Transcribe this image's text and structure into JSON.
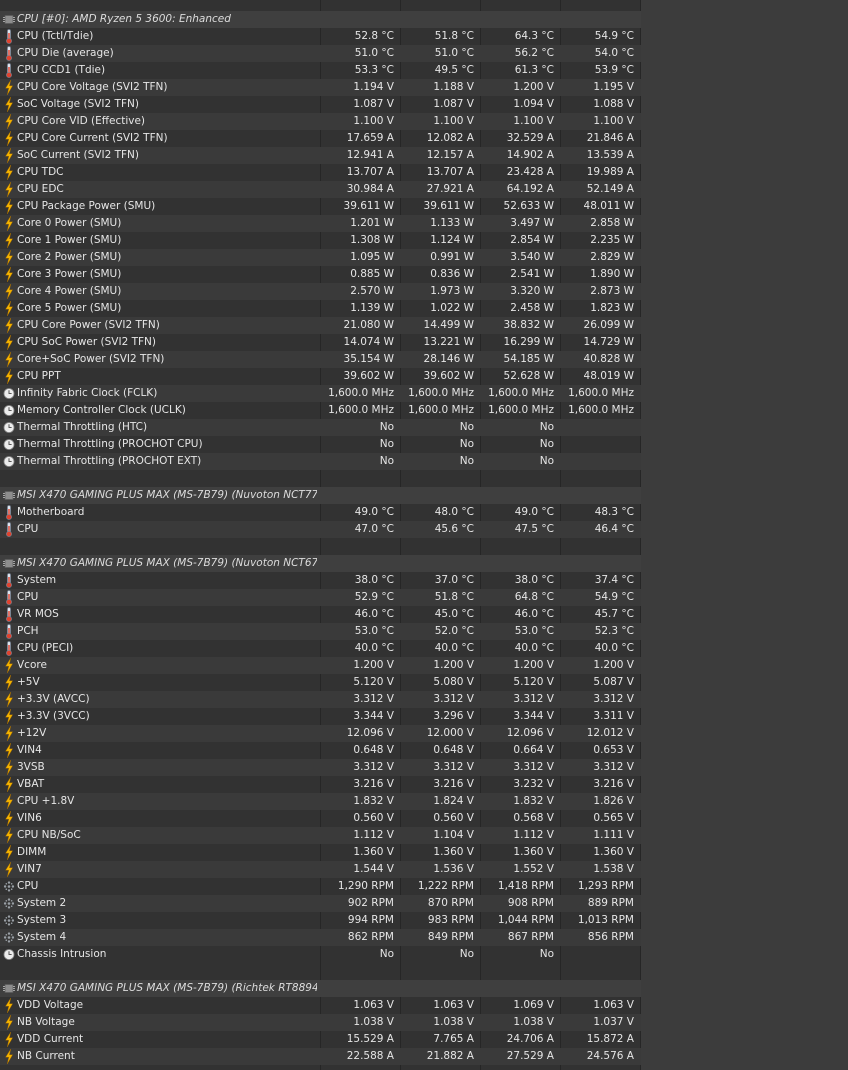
{
  "sections": [
    {
      "title": "CPU [#0]: AMD Ryzen 5 3600: Enhanced",
      "icon": "chip-icon",
      "rows": [
        {
          "icon": "thermometer-icon",
          "label": "CPU (Tctl/Tdie)",
          "values": [
            "52.8 °C",
            "51.8 °C",
            "64.3 °C",
            "54.9 °C"
          ]
        },
        {
          "icon": "thermometer-icon",
          "label": "CPU Die (average)",
          "values": [
            "51.0 °C",
            "51.0 °C",
            "56.2 °C",
            "54.0 °C"
          ]
        },
        {
          "icon": "thermometer-icon",
          "label": "CPU CCD1 (Tdie)",
          "values": [
            "53.3 °C",
            "49.5 °C",
            "61.3 °C",
            "53.9 °C"
          ]
        },
        {
          "icon": "lightning-icon",
          "label": "CPU Core Voltage (SVI2 TFN)",
          "values": [
            "1.194 V",
            "1.188 V",
            "1.200 V",
            "1.195 V"
          ]
        },
        {
          "icon": "lightning-icon",
          "label": "SoC Voltage (SVI2 TFN)",
          "values": [
            "1.087 V",
            "1.087 V",
            "1.094 V",
            "1.088 V"
          ]
        },
        {
          "icon": "lightning-icon",
          "label": "CPU Core VID (Effective)",
          "values": [
            "1.100 V",
            "1.100 V",
            "1.100 V",
            "1.100 V"
          ]
        },
        {
          "icon": "lightning-icon",
          "label": "CPU Core Current (SVI2 TFN)",
          "values": [
            "17.659 A",
            "12.082 A",
            "32.529 A",
            "21.846 A"
          ]
        },
        {
          "icon": "lightning-icon",
          "label": "SoC Current (SVI2 TFN)",
          "values": [
            "12.941 A",
            "12.157 A",
            "14.902 A",
            "13.539 A"
          ]
        },
        {
          "icon": "lightning-icon",
          "label": "CPU TDC",
          "values": [
            "13.707 A",
            "13.707 A",
            "23.428 A",
            "19.989 A"
          ]
        },
        {
          "icon": "lightning-icon",
          "label": "CPU EDC",
          "values": [
            "30.984 A",
            "27.921 A",
            "64.192 A",
            "52.149 A"
          ]
        },
        {
          "icon": "lightning-icon",
          "label": "CPU Package Power (SMU)",
          "values": [
            "39.611 W",
            "39.611 W",
            "52.633 W",
            "48.011 W"
          ]
        },
        {
          "icon": "lightning-icon",
          "label": "Core 0 Power (SMU)",
          "values": [
            "1.201 W",
            "1.133 W",
            "3.497 W",
            "2.858 W"
          ]
        },
        {
          "icon": "lightning-icon",
          "label": "Core 1 Power (SMU)",
          "values": [
            "1.308 W",
            "1.124 W",
            "2.854 W",
            "2.235 W"
          ]
        },
        {
          "icon": "lightning-icon",
          "label": "Core 2 Power (SMU)",
          "values": [
            "1.095 W",
            "0.991 W",
            "3.540 W",
            "2.829 W"
          ]
        },
        {
          "icon": "lightning-icon",
          "label": "Core 3 Power (SMU)",
          "values": [
            "0.885 W",
            "0.836 W",
            "2.541 W",
            "1.890 W"
          ]
        },
        {
          "icon": "lightning-icon",
          "label": "Core 4 Power (SMU)",
          "values": [
            "2.570 W",
            "1.973 W",
            "3.320 W",
            "2.873 W"
          ]
        },
        {
          "icon": "lightning-icon",
          "label": "Core 5 Power (SMU)",
          "values": [
            "1.139 W",
            "1.022 W",
            "2.458 W",
            "1.823 W"
          ]
        },
        {
          "icon": "lightning-icon",
          "label": "CPU Core Power (SVI2 TFN)",
          "values": [
            "21.080 W",
            "14.499 W",
            "38.832 W",
            "26.099 W"
          ]
        },
        {
          "icon": "lightning-icon",
          "label": "CPU SoC Power (SVI2 TFN)",
          "values": [
            "14.074 W",
            "13.221 W",
            "16.299 W",
            "14.729 W"
          ]
        },
        {
          "icon": "lightning-icon",
          "label": "Core+SoC Power (SVI2 TFN)",
          "values": [
            "35.154 W",
            "28.146 W",
            "54.185 W",
            "40.828 W"
          ]
        },
        {
          "icon": "lightning-icon",
          "label": "CPU PPT",
          "values": [
            "39.602 W",
            "39.602 W",
            "52.628 W",
            "48.019 W"
          ]
        },
        {
          "icon": "clock-icon",
          "label": "Infinity Fabric Clock (FCLK)",
          "values": [
            "1,600.0 MHz",
            "1,600.0 MHz",
            "1,600.0 MHz",
            "1,600.0 MHz"
          ]
        },
        {
          "icon": "clock-icon",
          "label": "Memory Controller Clock (UCLK)",
          "values": [
            "1,600.0 MHz",
            "1,600.0 MHz",
            "1,600.0 MHz",
            "1,600.0 MHz"
          ]
        },
        {
          "icon": "clock-icon",
          "label": "Thermal Throttling (HTC)",
          "values": [
            "No",
            "No",
            "No",
            ""
          ]
        },
        {
          "icon": "clock-icon",
          "label": "Thermal Throttling (PROCHOT CPU)",
          "values": [
            "No",
            "No",
            "No",
            ""
          ]
        },
        {
          "icon": "clock-icon",
          "label": "Thermal Throttling (PROCHOT EXT)",
          "values": [
            "No",
            "No",
            "No",
            ""
          ]
        }
      ]
    },
    {
      "title": "MSI X470 GAMING PLUS MAX (MS-7B79) (Nuvoton NCT7717...",
      "icon": "chip-icon",
      "rows": [
        {
          "icon": "thermometer-icon",
          "label": "Motherboard",
          "values": [
            "49.0 °C",
            "48.0 °C",
            "49.0 °C",
            "48.3 °C"
          ]
        },
        {
          "icon": "thermometer-icon",
          "label": "CPU",
          "values": [
            "47.0 °C",
            "45.6 °C",
            "47.5 °C",
            "46.4 °C"
          ]
        }
      ]
    },
    {
      "title": "MSI X470 GAMING PLUS MAX (MS-7B79) (Nuvoton NCT6795D)",
      "icon": "chip-icon",
      "rows": [
        {
          "icon": "thermometer-icon",
          "label": "System",
          "values": [
            "38.0 °C",
            "37.0 °C",
            "38.0 °C",
            "37.4 °C"
          ]
        },
        {
          "icon": "thermometer-icon",
          "label": "CPU",
          "values": [
            "52.9 °C",
            "51.8 °C",
            "64.8 °C",
            "54.9 °C"
          ]
        },
        {
          "icon": "thermometer-icon",
          "label": "VR MOS",
          "values": [
            "46.0 °C",
            "45.0 °C",
            "46.0 °C",
            "45.7 °C"
          ]
        },
        {
          "icon": "thermometer-icon",
          "label": "PCH",
          "values": [
            "53.0 °C",
            "52.0 °C",
            "53.0 °C",
            "52.3 °C"
          ]
        },
        {
          "icon": "thermometer-icon",
          "label": "CPU (PECI)",
          "values": [
            "40.0 °C",
            "40.0 °C",
            "40.0 °C",
            "40.0 °C"
          ]
        },
        {
          "icon": "lightning-icon",
          "label": "Vcore",
          "values": [
            "1.200 V",
            "1.200 V",
            "1.200 V",
            "1.200 V"
          ]
        },
        {
          "icon": "lightning-icon",
          "label": "+5V",
          "values": [
            "5.120 V",
            "5.080 V",
            "5.120 V",
            "5.087 V"
          ]
        },
        {
          "icon": "lightning-icon",
          "label": "+3.3V (AVCC)",
          "values": [
            "3.312 V",
            "3.312 V",
            "3.312 V",
            "3.312 V"
          ]
        },
        {
          "icon": "lightning-icon",
          "label": "+3.3V (3VCC)",
          "values": [
            "3.344 V",
            "3.296 V",
            "3.344 V",
            "3.311 V"
          ]
        },
        {
          "icon": "lightning-icon",
          "label": "+12V",
          "values": [
            "12.096 V",
            "12.000 V",
            "12.096 V",
            "12.012 V"
          ]
        },
        {
          "icon": "lightning-icon",
          "label": "VIN4",
          "values": [
            "0.648 V",
            "0.648 V",
            "0.664 V",
            "0.653 V"
          ]
        },
        {
          "icon": "lightning-icon",
          "label": "3VSB",
          "values": [
            "3.312 V",
            "3.312 V",
            "3.312 V",
            "3.312 V"
          ]
        },
        {
          "icon": "lightning-icon",
          "label": "VBAT",
          "values": [
            "3.216 V",
            "3.216 V",
            "3.232 V",
            "3.216 V"
          ]
        },
        {
          "icon": "lightning-icon",
          "label": "CPU +1.8V",
          "values": [
            "1.832 V",
            "1.824 V",
            "1.832 V",
            "1.826 V"
          ]
        },
        {
          "icon": "lightning-icon",
          "label": "VIN6",
          "values": [
            "0.560 V",
            "0.560 V",
            "0.568 V",
            "0.565 V"
          ]
        },
        {
          "icon": "lightning-icon",
          "label": "CPU NB/SoC",
          "values": [
            "1.112 V",
            "1.104 V",
            "1.112 V",
            "1.111 V"
          ]
        },
        {
          "icon": "lightning-icon",
          "label": "DIMM",
          "values": [
            "1.360 V",
            "1.360 V",
            "1.360 V",
            "1.360 V"
          ]
        },
        {
          "icon": "lightning-icon",
          "label": "VIN7",
          "values": [
            "1.544 V",
            "1.536 V",
            "1.552 V",
            "1.538 V"
          ]
        },
        {
          "icon": "fan-icon",
          "label": "CPU",
          "values": [
            "1,290 RPM",
            "1,222 RPM",
            "1,418 RPM",
            "1,293 RPM"
          ]
        },
        {
          "icon": "fan-icon",
          "label": "System 2",
          "values": [
            "902 RPM",
            "870 RPM",
            "908 RPM",
            "889 RPM"
          ]
        },
        {
          "icon": "fan-icon",
          "label": "System 3",
          "values": [
            "994 RPM",
            "983 RPM",
            "1,044 RPM",
            "1,013 RPM"
          ]
        },
        {
          "icon": "fan-icon",
          "label": "System 4",
          "values": [
            "862 RPM",
            "849 RPM",
            "867 RPM",
            "856 RPM"
          ]
        },
        {
          "icon": "clock-icon",
          "label": "Chassis Intrusion",
          "values": [
            "No",
            "No",
            "No",
            ""
          ]
        }
      ]
    },
    {
      "title": "MSI X470 GAMING PLUS MAX (MS-7B79) (Richtek RT8894A/...",
      "icon": "chip-icon",
      "rows": [
        {
          "icon": "lightning-icon",
          "label": "VDD Voltage",
          "values": [
            "1.063 V",
            "1.063 V",
            "1.069 V",
            "1.063 V"
          ]
        },
        {
          "icon": "lightning-icon",
          "label": "NB Voltage",
          "values": [
            "1.038 V",
            "1.038 V",
            "1.038 V",
            "1.037 V"
          ]
        },
        {
          "icon": "lightning-icon",
          "label": "VDD Current",
          "values": [
            "15.529 A",
            "7.765 A",
            "24.706 A",
            "15.872 A"
          ]
        },
        {
          "icon": "lightning-icon",
          "label": "NB Current",
          "values": [
            "22.588 A",
            "21.882 A",
            "27.529 A",
            "24.576 A"
          ]
        }
      ]
    }
  ]
}
